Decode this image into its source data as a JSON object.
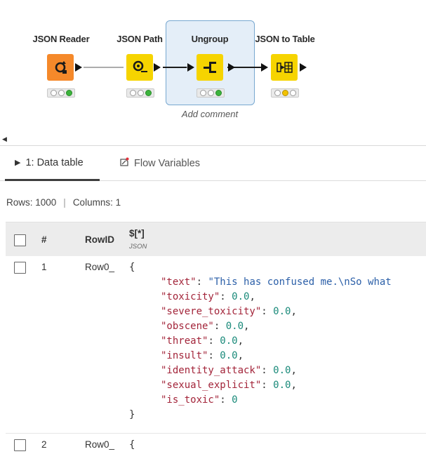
{
  "workflow": {
    "nodes": [
      {
        "label": "JSON Reader",
        "icon": "json-reader-icon",
        "color": "#f5892a",
        "status": [
          "off",
          "off",
          "green"
        ]
      },
      {
        "label": "JSON Path",
        "icon": "json-path-icon",
        "color": "#f6d400",
        "status": [
          "off",
          "off",
          "green"
        ]
      },
      {
        "label": "Ungroup",
        "icon": "ungroup-icon",
        "color": "#f6d400",
        "status": [
          "off",
          "off",
          "green"
        ]
      },
      {
        "label": "JSON to Table",
        "icon": "json-to-table-icon",
        "color": "#f6d400",
        "status": [
          "off",
          "yellow",
          "off"
        ]
      }
    ],
    "add_comment": "Add comment"
  },
  "tabs": [
    {
      "label": "1: Data table",
      "icon": "play-icon"
    },
    {
      "label": "Flow Variables",
      "icon": "flow-variable-icon"
    }
  ],
  "summary": {
    "rows": "Rows: 1000",
    "sep": "|",
    "columns": "Columns: 1"
  },
  "table": {
    "headers": {
      "index": "#",
      "rowid": "RowID",
      "col": "$[*]",
      "col_type": "JSON"
    },
    "rows": [
      {
        "index": "1",
        "rowid": "Row0_",
        "json_open": "{",
        "json_lines": [
          {
            "key": "\"text\"",
            "value": "\"This has confused me.\\nSo what",
            "vtype": "s",
            "comma": false
          },
          {
            "key": "\"toxicity\"",
            "value": "0.0",
            "vtype": "n",
            "comma": true
          },
          {
            "key": "\"severe_toxicity\"",
            "value": "0.0",
            "vtype": "n",
            "comma": true
          },
          {
            "key": "\"obscene\"",
            "value": "0.0",
            "vtype": "n",
            "comma": true
          },
          {
            "key": "\"threat\"",
            "value": "0.0",
            "vtype": "n",
            "comma": true
          },
          {
            "key": "\"insult\"",
            "value": "0.0",
            "vtype": "n",
            "comma": true
          },
          {
            "key": "\"identity_attack\"",
            "value": "0.0",
            "vtype": "n",
            "comma": true
          },
          {
            "key": "\"sexual_explicit\"",
            "value": "0.0",
            "vtype": "n",
            "comma": true
          },
          {
            "key": "\"is_toxic\"",
            "value": "0",
            "vtype": "n",
            "comma": false
          }
        ],
        "json_close": "}"
      },
      {
        "index": "2",
        "rowid": "Row0_",
        "json_open": "{"
      }
    ]
  }
}
